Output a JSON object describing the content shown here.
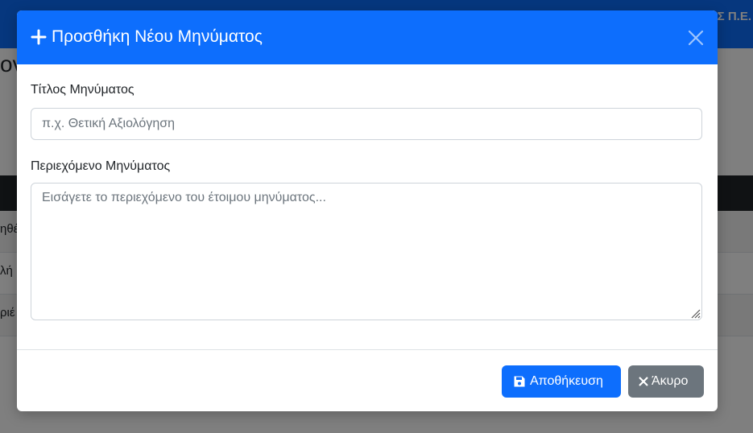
{
  "background": {
    "topbar_text": "Σ Π.Ε.",
    "page_title_fragment": "ον",
    "rows": [
      "ηθέ",
      "λή",
      "ριέ"
    ]
  },
  "modal": {
    "title": "Προσθήκη Νέου Μηνύματος",
    "title_icon": "plus-icon",
    "close_icon": "close-icon",
    "fields": {
      "title": {
        "label": "Τίτλος Μηνύματος",
        "value": "",
        "placeholder": "π.χ. Θετική Αξιολόγηση"
      },
      "content": {
        "label": "Περιεχόμενο Μηνύματος",
        "value": "",
        "placeholder": "Εισάγετε το περιεχόμενο του έτοιμου μηνύματος..."
      }
    },
    "buttons": {
      "save_label": "Αποθήκευση",
      "save_icon": "floppy-disk-icon",
      "cancel_label": "Άκυρο",
      "cancel_icon": "x-icon"
    }
  },
  "colors": {
    "primary": "#0d6efd",
    "secondary": "#6c757d",
    "backdrop": "rgba(0,0,0,0.5)"
  }
}
